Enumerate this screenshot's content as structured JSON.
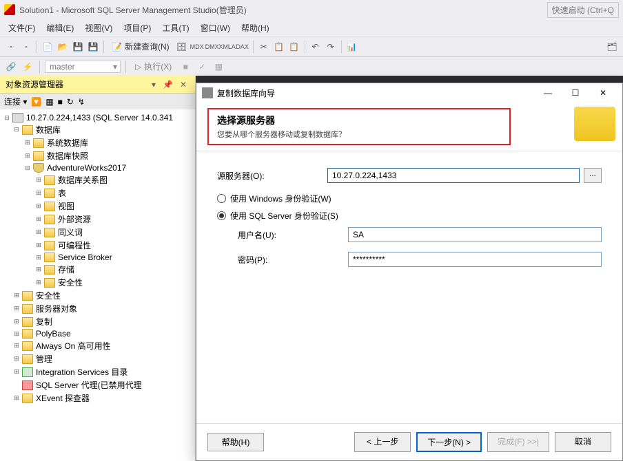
{
  "titlebar": {
    "title": "Solution1 - Microsoft SQL Server Management Studio(管理员)",
    "quick_launch": "快速启动 (Ctrl+Q"
  },
  "menubar": {
    "file": "文件(F)",
    "edit": "编辑(E)",
    "view": "视图(V)",
    "project": "项目(P)",
    "tools": "工具(T)",
    "window": "窗口(W)",
    "help": "帮助(H)"
  },
  "toolbar": {
    "new_query": "新建查询(N)",
    "execute": "执行(X)",
    "db_combo": "master"
  },
  "explorer": {
    "title": "对象资源管理器",
    "connect_label": "连接 ▾",
    "server": "10.27.0.224,1433 (SQL Server 14.0.341",
    "databases": "数据库",
    "system_db": "系统数据库",
    "db_snapshot": "数据库快照",
    "adventure": "AdventureWorks2017",
    "diagrams": "数据库关系图",
    "tables": "表",
    "views": "视图",
    "ext_res": "外部资源",
    "synonyms": "同义词",
    "programmability": "可编程性",
    "service_broker": "Service Broker",
    "storage": "存储",
    "security_db": "安全性",
    "security": "安全性",
    "server_objects": "服务器对象",
    "replication": "复制",
    "polybase": "PolyBase",
    "always_on": "Always On 高可用性",
    "management": "管理",
    "integration": "Integration Services 目录",
    "sql_agent": "SQL Server 代理(已禁用代理",
    "xevent": "XEvent 探查器"
  },
  "wizard": {
    "window_title": "复制数据库向导",
    "heading": "选择源服务器",
    "subheading": "您要从哪个服务器移动或复制数据库？",
    "source_server_label": "源服务器(O):",
    "source_server_value": "10.27.0.224,1433",
    "browse": "...",
    "auth_windows": "使用 Windows 身份验证(W)",
    "auth_sql": "使用 SQL Server 身份验证(S)",
    "username_label": "用户名(U):",
    "username_value": "SA",
    "password_label": "密码(P):",
    "password_value": "**********",
    "help_btn": "帮助(H)",
    "back_btn": "< 上一步",
    "next_btn": "下一步(N) >",
    "finish_btn": "完成(F) >>|",
    "cancel_btn": "取消",
    "min": "—",
    "max": "☐",
    "close": "✕"
  }
}
